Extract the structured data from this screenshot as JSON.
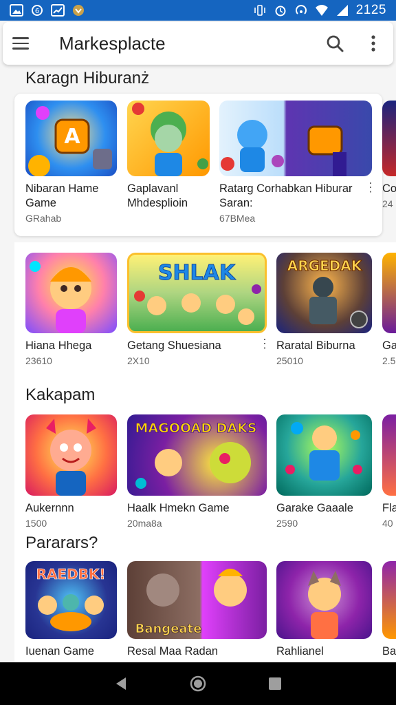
{
  "status_bar": {
    "time": "2125"
  },
  "app_bar": {
    "title": "Markesplacte"
  },
  "sections": [
    {
      "title": "Karagn Hiburanż",
      "items": [
        {
          "title": "Nibaran Hame\nGame",
          "sub": "GRahab"
        },
        {
          "title": "Gaplavanl\nMhdesplioin",
          "sub": ""
        },
        {
          "title": "Ratarg Corhabkan Hiburar\nSaran:",
          "sub": "67BMea"
        },
        {
          "title": "Co",
          "sub": "24"
        }
      ]
    },
    {
      "title": "",
      "items": [
        {
          "title": "Hiana Hhega",
          "sub": "23610",
          "thumb_text": ""
        },
        {
          "title": "Getang Shuesiana",
          "sub": "2X10",
          "thumb_text": "SHLAK"
        },
        {
          "title": "Raratal Biburna",
          "sub": "25010",
          "thumb_text": "ARGEDAK"
        },
        {
          "title": "Ga",
          "sub": "2.5"
        }
      ]
    },
    {
      "title": "Kakapam",
      "items": [
        {
          "title": "Aukernnn",
          "sub": "1500"
        },
        {
          "title": "Haalk Hmekn Game",
          "sub": "20ma8a",
          "thumb_text": "MAGOOAD DAKS"
        },
        {
          "title": "Garake Gaaale",
          "sub": "2590"
        },
        {
          "title": "Fla",
          "sub": "40"
        }
      ]
    },
    {
      "title": "Pararars?",
      "items": [
        {
          "title": "Iuenan Game",
          "sub": "",
          "thumb_text": "RAEDBK!"
        },
        {
          "title": "Resal Maa Radan",
          "sub": "",
          "thumb_text": "Bangeate"
        },
        {
          "title": "Rahlianel",
          "sub": ""
        },
        {
          "title": "Ba",
          "sub": ""
        }
      ]
    }
  ],
  "colors": {
    "status_bar": "#1565c0",
    "nav_bar": "#000000",
    "background": "#f5f5f5"
  }
}
